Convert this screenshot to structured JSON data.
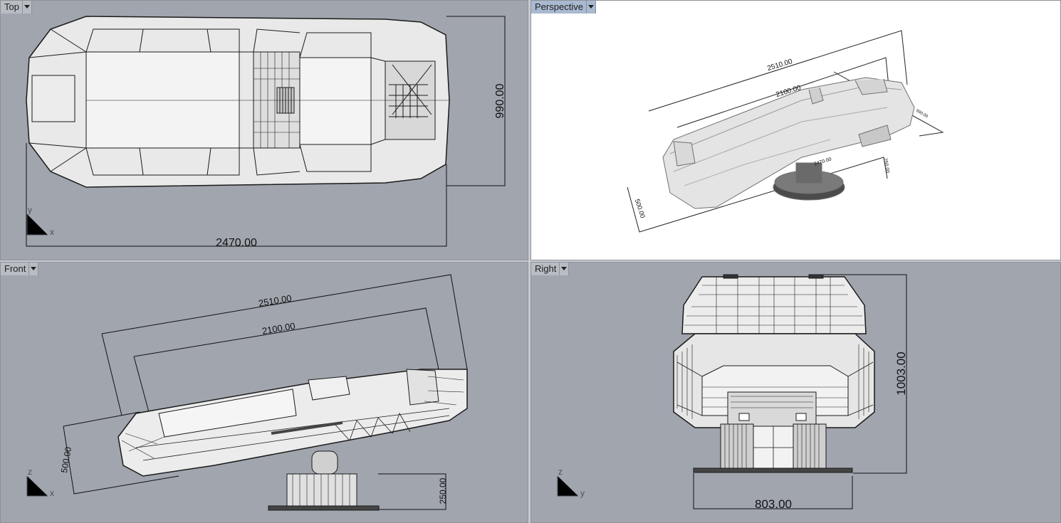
{
  "viewports": {
    "top": {
      "label": "Top",
      "dims": {
        "length": "2470.00",
        "width": "990.00"
      },
      "axes": {
        "h": "x",
        "v": "y"
      }
    },
    "perspective": {
      "label": "Perspective",
      "dims": {
        "outer": "2510.00",
        "inner": "2100.00",
        "height": "500.00",
        "small_a": "250.00",
        "small_b": "2470.00",
        "small_c": "990.00"
      }
    },
    "front": {
      "label": "Front",
      "dims": {
        "outer": "2510.00",
        "inner": "2100.00",
        "height": "500.00",
        "base": "250.00"
      },
      "axes": {
        "h": "x",
        "v": "z"
      }
    },
    "right": {
      "label": "Right",
      "dims": {
        "height": "1003.00",
        "width": "803.00"
      },
      "axes": {
        "h": "y",
        "v": "z"
      }
    }
  },
  "colors": {
    "viewport_bg": "#a0a5ae",
    "active_bg": "#ffffff",
    "active_tab": "#a9b9d0",
    "model_fill": "#eeeeee",
    "wire": "#1a1a1a"
  }
}
